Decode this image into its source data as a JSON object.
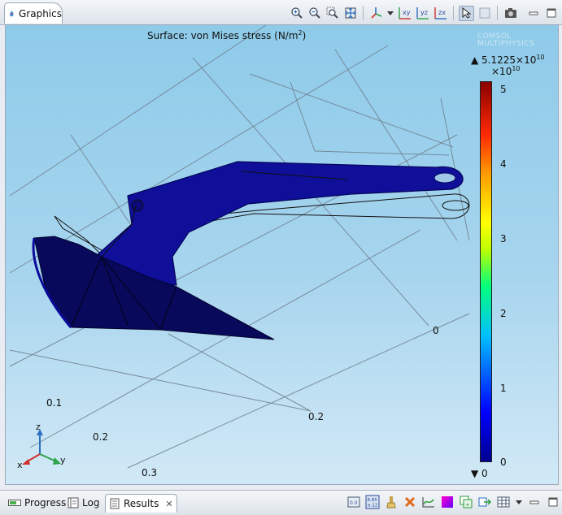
{
  "window": {
    "tab_title": "Graphics"
  },
  "toolbar": {
    "icons": [
      "zoom-in-icon",
      "zoom-out-icon",
      "zoom-box-icon",
      "zoom-extents-icon",
      "axis-orientation-icon",
      "dropdown-arrow-icon",
      "view-xy-icon",
      "view-yz-icon",
      "view-zx-icon",
      "select-mode-icon",
      "transparency-icon",
      "screenshot-icon",
      "minimize-icon",
      "maximize-icon"
    ],
    "labels": {
      "xy": "xy",
      "yz": "yz",
      "zx": "zx"
    }
  },
  "plot": {
    "title_prefix": "Surface: von Mises stress (N/m",
    "title_exp": "2",
    "title_suffix": ")",
    "colorbar": {
      "max_label": "5.1225×10",
      "max_exp": "10",
      "multiplier": "×10",
      "multiplier_exp": "10",
      "min_label": "0",
      "ticks": [
        "5",
        "4",
        "3",
        "2",
        "1",
        "0"
      ],
      "colors": {
        "low": "#00008f",
        "high": "#8a0000"
      }
    },
    "axis_ticks": [
      "0",
      "0.1",
      "0.2",
      "0.3",
      "0.2"
    ],
    "triad": {
      "x": "x",
      "y": "y",
      "z": "z"
    },
    "part_color": "#10108a"
  },
  "bottom_panel": {
    "tabs": [
      {
        "label": "Progress",
        "icon": "progress-icon"
      },
      {
        "label": "Log",
        "icon": "log-icon"
      },
      {
        "label": "Results",
        "icon": "results-icon"
      }
    ],
    "close_glyph": "✕",
    "precision_badge": "8.85\ne-12"
  }
}
